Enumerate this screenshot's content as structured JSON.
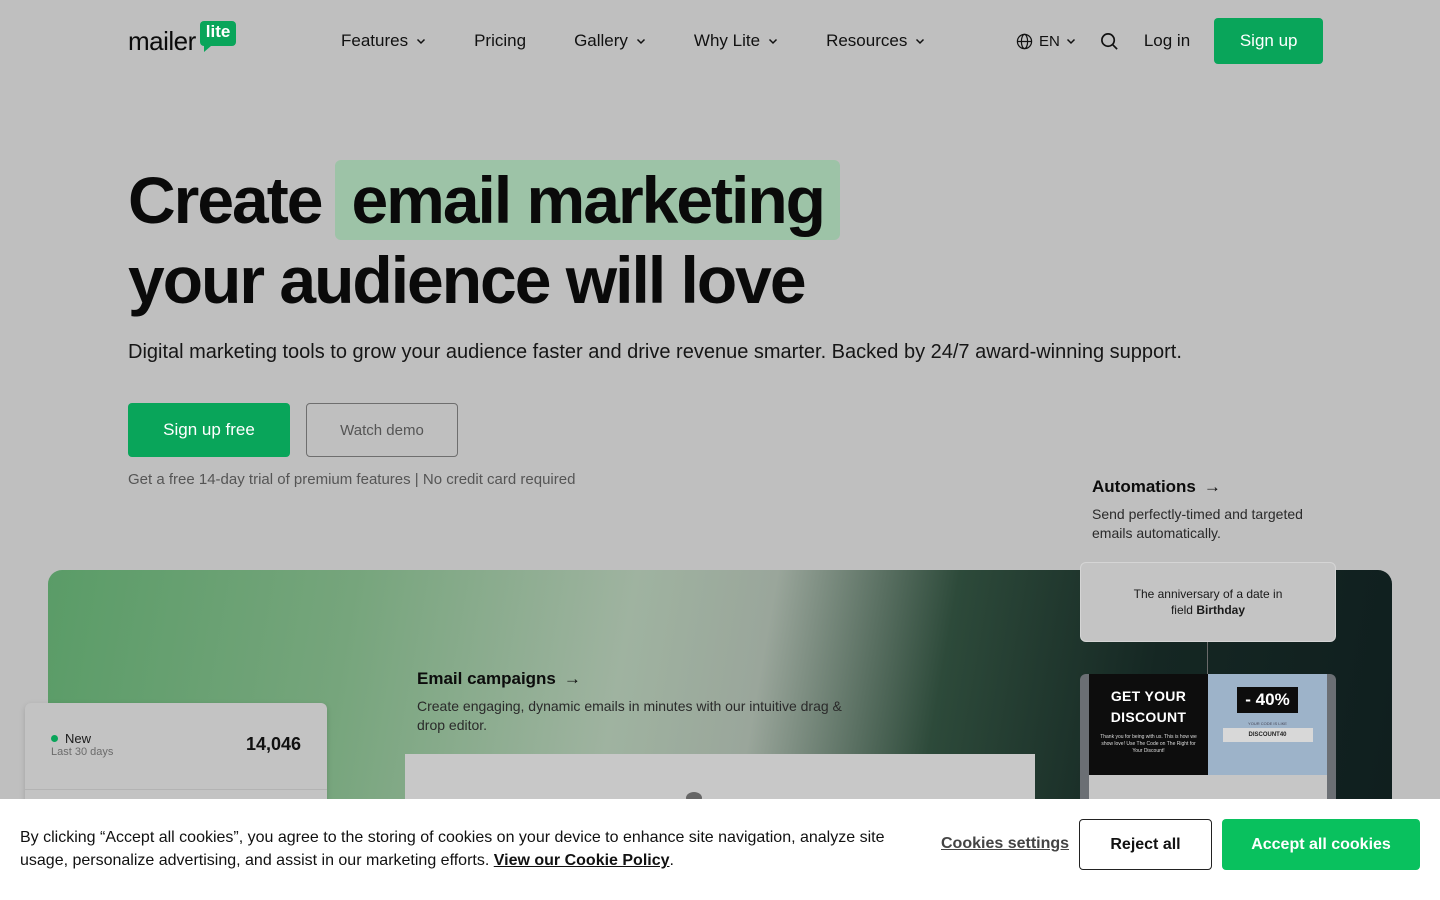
{
  "brand": {
    "word": "mailer",
    "badge": "lite"
  },
  "nav": {
    "items": [
      {
        "label": "Features",
        "dropdown": true
      },
      {
        "label": "Pricing",
        "dropdown": false
      },
      {
        "label": "Gallery",
        "dropdown": true
      },
      {
        "label": "Why Lite",
        "dropdown": true
      },
      {
        "label": "Resources",
        "dropdown": true
      }
    ],
    "language": "EN",
    "login": "Log in",
    "signup": "Sign up"
  },
  "hero": {
    "line1_prefix": "Create",
    "line1_highlight": "email marketing",
    "line2": "your audience will love",
    "subtitle": "Digital marketing tools to grow your audience faster and drive revenue smarter. Backed by 24/7 award-winning support.",
    "cta_primary": "Sign up free",
    "cta_secondary": "Watch demo",
    "trial_note": "Get a free 14-day trial of premium features | No credit card required"
  },
  "features": {
    "automations": {
      "title": "Automations",
      "arrow": "→",
      "desc": "Send perfectly-timed and targeted emails automatically."
    },
    "email_campaigns": {
      "title": "Email campaigns",
      "arrow": "→",
      "desc": "Create engaging, dynamic emails in minutes with our intuitive drag & drop editor."
    }
  },
  "stat_card": {
    "label": "New",
    "period": "Last 30 days",
    "value": "14,046"
  },
  "automation_card": {
    "line1": "The anniversary of a date in",
    "line2_prefix": "field",
    "line2_bold": "Birthday"
  },
  "discount_card": {
    "headline1": "GET YOUR",
    "headline2": "DISCOUNT",
    "fine_print": "Thank you for being with us. This is how we show love! Use The Code on The Right for Your Discount!",
    "percent": "- 40%",
    "code_label": "YOUR CODE IS LIKE",
    "code": "DISCOUNT40"
  },
  "cookie": {
    "text": "By clicking “Accept all cookies”, you agree to the storing of cookies on your device to enhance site navigation, analyze site usage, personalize advertising, and assist in our marketing efforts.",
    "policy_link": "View our Cookie Policy",
    "period": ".",
    "settings": "Cookies settings",
    "reject": "Reject all",
    "accept": "Accept all cookies"
  },
  "colors": {
    "accent": "#09a55a",
    "accept": "#09c15e",
    "highlight": "#9dc3a7",
    "background": "#bfbfbf"
  }
}
